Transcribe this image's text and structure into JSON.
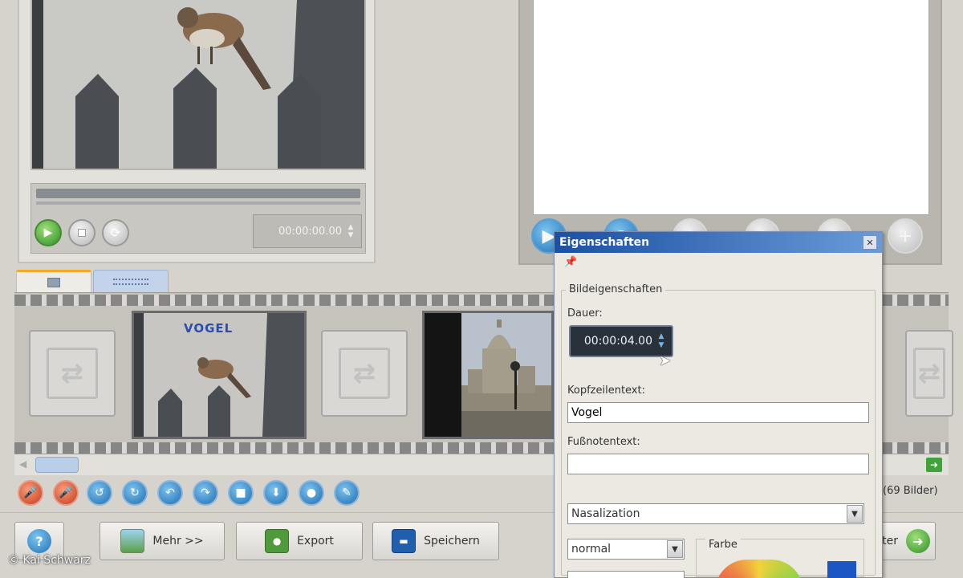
{
  "preview": {
    "timecode": "00:00:00.00"
  },
  "tabs": {
    "photos_tab_icon": "photo-tab-icon",
    "timeline_tab_icon": "timeline-tab-icon"
  },
  "filmstrip": {
    "clips": [
      {
        "title": "VOGEL"
      }
    ]
  },
  "status": {
    "image_count": "(69 Bilder)"
  },
  "buttons": {
    "more_label": "Mehr >>",
    "export_label": "Export",
    "save_label": "Speichern",
    "next_label": "ter"
  },
  "copyright": "© Kai Schwarz",
  "properties_dialog": {
    "title": "Eigenschaften",
    "group_title": "Bildeigenschaften",
    "duration_label": "Dauer:",
    "duration_value": "00:00:04.00",
    "header_label": "Kopfzeilentext:",
    "header_value": "Vogel",
    "footnote_label": "Fußnotentext:",
    "footnote_value": "",
    "font_value": "Nasalization",
    "style_value": "normal",
    "color_label": "Farbe",
    "swatch_color": "#1b56c4"
  },
  "colors": {
    "accent_blue": "#1e6db0",
    "title_bar": "#1c50a2",
    "record_red": "#c63b18",
    "play_green": "#2c8f24"
  }
}
